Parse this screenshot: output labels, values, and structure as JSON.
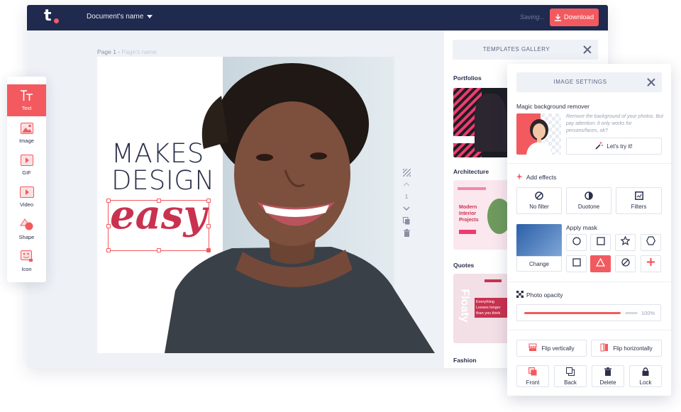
{
  "topbar": {
    "document_name": "Document's name",
    "saving_text": "Saving...",
    "download_label": "Download"
  },
  "canvas": {
    "page_label": "Page 1 -",
    "page_placeholder": "Page's name",
    "tagline_line1": "MAKES",
    "tagline_line2": "DESIGN",
    "tagline_script": "easy",
    "page_number": "1"
  },
  "toolbar": {
    "items": [
      {
        "label": "Text",
        "icon": "text-icon"
      },
      {
        "label": "Image",
        "icon": "image-icon"
      },
      {
        "label": "GIF",
        "icon": "gif-icon"
      },
      {
        "label": "Video",
        "icon": "video-icon"
      },
      {
        "label": "Shape",
        "icon": "shape-icon"
      },
      {
        "label": "Icon",
        "icon": "icon-icon"
      }
    ],
    "active": "Text"
  },
  "gallery": {
    "title": "TEMPLATES GALLERY",
    "categories": [
      "Portfolios",
      "Architecture",
      "Quotes",
      "Fashion"
    ],
    "thumb_texts": {
      "architecture": "Modern Interior Projects",
      "quotes_vertical": "Floaty",
      "quotes": "Everything Looses longer than you think"
    }
  },
  "settings": {
    "title": "IMAGE SETTINGS",
    "bg_remover_label": "Magic background remover",
    "bg_remover_note": "Remove the background of your photos. But pay attention: it only works for persons/faces, ok?",
    "try_label": "Let's try it!",
    "effects_label": "Add effects",
    "effects": [
      "No filter",
      "Duotone",
      "Filters"
    ],
    "mask_label": "Apply mask",
    "change_label": "Change",
    "opacity_label": "Photo opacity",
    "opacity_value": "100%",
    "opacity_level": 0.88,
    "flip_vertical": "Flip vertically",
    "flip_horizontal": "Flip horizontally",
    "order": [
      "Front",
      "Back",
      "Delete",
      "Lock"
    ]
  },
  "colors": {
    "accent": "#f25a5f",
    "navy": "#1f2a4e",
    "text_dark": "#2a2f4a",
    "script_red": "#c9324f"
  }
}
